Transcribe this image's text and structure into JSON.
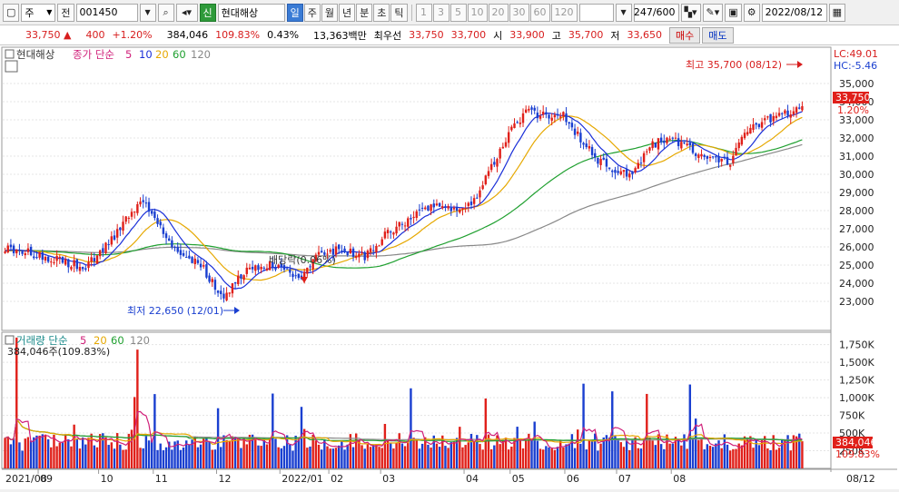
{
  "toolbar": {
    "market_code": "주",
    "prev_label": "전",
    "stock_code": "001450",
    "credit_badge": "신",
    "stock_name": "현대해상",
    "period_buttons": [
      {
        "label": "일",
        "selected": true
      },
      {
        "label": "주",
        "selected": false
      },
      {
        "label": "월",
        "selected": false
      },
      {
        "label": "년",
        "selected": false
      },
      {
        "label": "분",
        "selected": false
      },
      {
        "label": "초",
        "selected": false
      },
      {
        "label": "틱",
        "selected": false
      }
    ],
    "interval_buttons": [
      "1",
      "3",
      "5",
      "10",
      "20",
      "30",
      "60",
      "120"
    ],
    "data_count": "247/600",
    "date": "2022/08/12"
  },
  "quote": {
    "price": "33,750",
    "change_arrow": "▲",
    "change": "400",
    "change_pct": "+1.20%",
    "volume": "384,046",
    "volume_ratio": "109.83%",
    "turnover": "0.43%",
    "amount": "13,363백만",
    "best_ask_label": "최우선",
    "best_ask": "33,750",
    "best_bid": "33,700",
    "open_label": "시",
    "open": "33,900",
    "high_label": "고",
    "high": "35,700",
    "low_label": "저",
    "low": "33,650",
    "buy_label": "매수",
    "sell_label": "매도"
  },
  "colors": {
    "up": "#e0201a",
    "down": "#1a3fd0",
    "ma5": "#1a2fd8",
    "ma20": "#e6a800",
    "ma60": "#20a030",
    "ma120": "#888888"
  },
  "price_panel": {
    "legend": {
      "name": "현대해상",
      "prefix": "종가 단순",
      "ma": [
        "5",
        "10",
        "20",
        "60",
        "120"
      ]
    },
    "lc_label": "LC:49.01",
    "hc_label": "HC:-5.46",
    "current_tag": "33,750",
    "pct_tag": "1.20%",
    "max_annotation": "최고 35,700 (08/12)",
    "min_annotation": "최저 22,650 (12/01)",
    "dividend_annotation": "배당락(0.06%)"
  },
  "volume_panel": {
    "legend": {
      "prefix": "거래량 단순",
      "ma": [
        "5",
        "20",
        "60",
        "120"
      ]
    },
    "current_label": "384,046주(109.83%)",
    "current_tag": "384,046",
    "pct_tag": "109.83%"
  },
  "chart_data": {
    "type": "candlestick",
    "price_axis": {
      "ylim": [
        22000,
        35500
      ],
      "ticks": [
        "35,000",
        "34,000",
        "33,000",
        "32,000",
        "31,000",
        "30,000",
        "29,000",
        "28,000",
        "27,000",
        "26,000",
        "25,000",
        "24,000",
        "23,000"
      ]
    },
    "volume_axis": {
      "ylim": [
        0,
        1900000
      ],
      "ticks": [
        "1,750K",
        "1,500K",
        "1,250K",
        "1,000K",
        "750K",
        "500K",
        "250K"
      ]
    },
    "x_labels": [
      "2021/08",
      "09",
      "10",
      "11",
      "12",
      "2022/01",
      "02",
      "03",
      "04",
      "05",
      "06",
      "07",
      "08"
    ],
    "last_date_label": "08/12",
    "close_anchors": [
      [
        0,
        26000
      ],
      [
        10,
        25600
      ],
      [
        20,
        25200
      ],
      [
        28,
        24900
      ],
      [
        34,
        25800
      ],
      [
        42,
        27500
      ],
      [
        48,
        28500
      ],
      [
        53,
        27200
      ],
      [
        60,
        25600
      ],
      [
        68,
        25000
      ],
      [
        76,
        23200
      ],
      [
        82,
        24500
      ],
      [
        90,
        25000
      ],
      [
        97,
        24900
      ],
      [
        103,
        24200
      ],
      [
        110,
        25800
      ],
      [
        118,
        25800
      ],
      [
        125,
        25400
      ],
      [
        132,
        26600
      ],
      [
        140,
        27500
      ],
      [
        148,
        28300
      ],
      [
        155,
        28000
      ],
      [
        162,
        28300
      ],
      [
        168,
        30000
      ],
      [
        174,
        32000
      ],
      [
        181,
        33400
      ],
      [
        188,
        33200
      ],
      [
        194,
        33200
      ],
      [
        200,
        32000
      ],
      [
        206,
        30700
      ],
      [
        212,
        30300
      ],
      [
        218,
        30000
      ],
      [
        224,
        31500
      ],
      [
        230,
        32000
      ],
      [
        236,
        31700
      ],
      [
        242,
        30900
      ],
      [
        248,
        30800
      ],
      [
        252,
        30600
      ],
      [
        256,
        32000
      ],
      [
        262,
        32800
      ],
      [
        268,
        33200
      ],
      [
        274,
        33400
      ],
      [
        277,
        33750
      ]
    ],
    "ma_last": {
      "ma5": 33500,
      "ma20": 33000,
      "ma60": 31700,
      "ma120": 31200
    }
  }
}
